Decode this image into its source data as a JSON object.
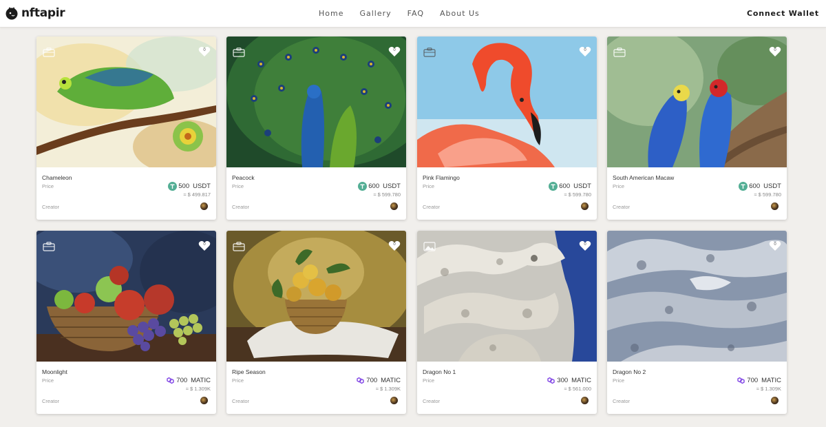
{
  "brand": {
    "name": "nftapir"
  },
  "nav": {
    "items": [
      "Home",
      "Gallery",
      "FAQ",
      "About Us"
    ]
  },
  "header": {
    "connect_label": "Connect Wallet"
  },
  "labels": {
    "price": "Price",
    "creator": "Creator"
  },
  "colors": {
    "usdt": "#53ae94",
    "matic": "#8247e5"
  },
  "cards": [
    {
      "title": "Chameleon",
      "likes": "0",
      "amount": "500",
      "currency": "USDT",
      "coin_icon": "tether-icon",
      "usd": "≈ $ 499.817"
    },
    {
      "title": "Peacock",
      "likes": "0",
      "amount": "600",
      "currency": "USDT",
      "coin_icon": "tether-icon",
      "usd": "≈ $ 599.780"
    },
    {
      "title": "Pink Flamingo",
      "likes": "0",
      "amount": "600",
      "currency": "USDT",
      "coin_icon": "tether-icon",
      "usd": "≈ $ 599.780"
    },
    {
      "title": "South American Macaw",
      "likes": "0",
      "amount": "600",
      "currency": "USDT",
      "coin_icon": "tether-icon",
      "usd": "≈ $ 599.780"
    },
    {
      "title": "Moonlight",
      "likes": "0",
      "amount": "700",
      "currency": "MATIC",
      "coin_icon": "polygon-icon",
      "usd": "≈ $ 1.309K"
    },
    {
      "title": "Ripe Season",
      "likes": "0",
      "amount": "700",
      "currency": "MATIC",
      "coin_icon": "polygon-icon",
      "usd": "≈ $ 1.309K"
    },
    {
      "title": "Dragon No 1",
      "likes": "0",
      "amount": "300",
      "currency": "MATIC",
      "coin_icon": "polygon-icon",
      "usd": "≈ $ 561.000"
    },
    {
      "title": "Dragon No 2",
      "likes": "0",
      "amount": "700",
      "currency": "MATIC",
      "coin_icon": "polygon-icon",
      "usd": "≈ $ 1.309K"
    }
  ]
}
